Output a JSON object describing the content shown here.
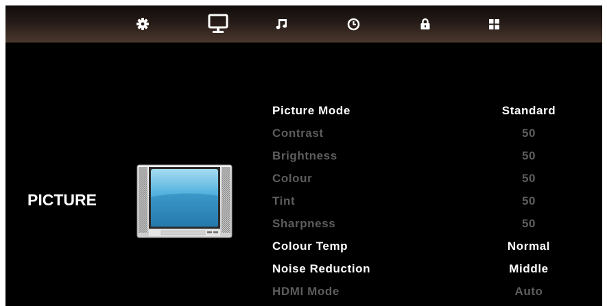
{
  "menu_tabs": [
    {
      "name": "setup",
      "icon": "gear-icon",
      "selected": false
    },
    {
      "name": "picture",
      "icon": "monitor-icon",
      "selected": true
    },
    {
      "name": "sound",
      "icon": "music-note-icon",
      "selected": false
    },
    {
      "name": "time",
      "icon": "clock-icon",
      "selected": false
    },
    {
      "name": "lock",
      "icon": "padlock-icon",
      "selected": false
    },
    {
      "name": "apps",
      "icon": "grid-icon",
      "selected": false
    }
  ],
  "section": {
    "title": "PICTURE",
    "illustration": "tv-icon"
  },
  "settings": [
    {
      "label": "Picture Mode",
      "value": "Standard",
      "enabled": true
    },
    {
      "label": "Contrast",
      "value": "50",
      "enabled": false
    },
    {
      "label": "Brightness",
      "value": "50",
      "enabled": false
    },
    {
      "label": "Colour",
      "value": "50",
      "enabled": false
    },
    {
      "label": "Tint",
      "value": "50",
      "enabled": false
    },
    {
      "label": "Sharpness",
      "value": "50",
      "enabled": false
    },
    {
      "label": "Colour Temp",
      "value": "Normal",
      "enabled": true
    },
    {
      "label": "Noise Reduction",
      "value": "Middle",
      "enabled": true
    },
    {
      "label": "HDMI Mode",
      "value": "Auto",
      "enabled": false
    }
  ],
  "colors": {
    "background": "#000000",
    "enabled_text": "#ffffff",
    "disabled_text": "#5d5d5d",
    "screen_blue": "#3a9fd0"
  }
}
